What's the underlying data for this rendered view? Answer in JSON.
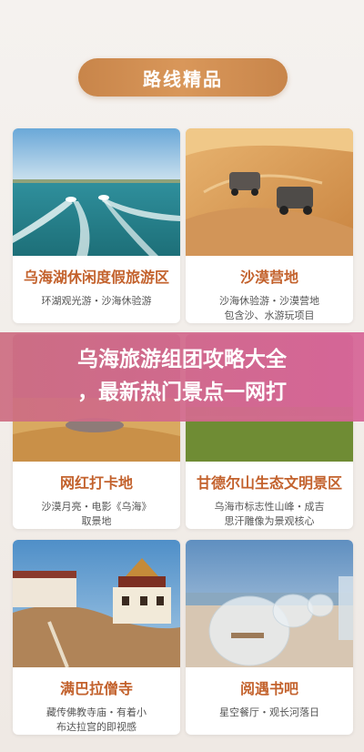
{
  "header": {
    "title": "路线精品"
  },
  "banner": {
    "line1": "乌海旅游组团攻略大全",
    "line2": "，最新热门景点一网打"
  },
  "cards": [
    {
      "title": "乌海湖休闲度假旅游区",
      "desc1": "环湖观光游・沙海休验游",
      "desc2": ""
    },
    {
      "title": "沙漠营地",
      "desc1": "沙海休验游・沙漠营地",
      "desc2": "包含沙、水游玩项目"
    },
    {
      "title": "网红打卡地",
      "desc1": "沙漠月亮・电影《乌海》",
      "desc2": "取景地"
    },
    {
      "title": "甘德尔山生态文明景区",
      "desc1": "乌海市标志性山峰・成吉",
      "desc2": "思汗雕像为景观核心"
    },
    {
      "title": "满巴拉僧寺",
      "desc1": "藏传佛教寺庙・有着小",
      "desc2": "布达拉宫的即视感"
    },
    {
      "title": "阅遇书吧",
      "desc1": "星空餐厅・观长河落日",
      "desc2": ""
    }
  ]
}
